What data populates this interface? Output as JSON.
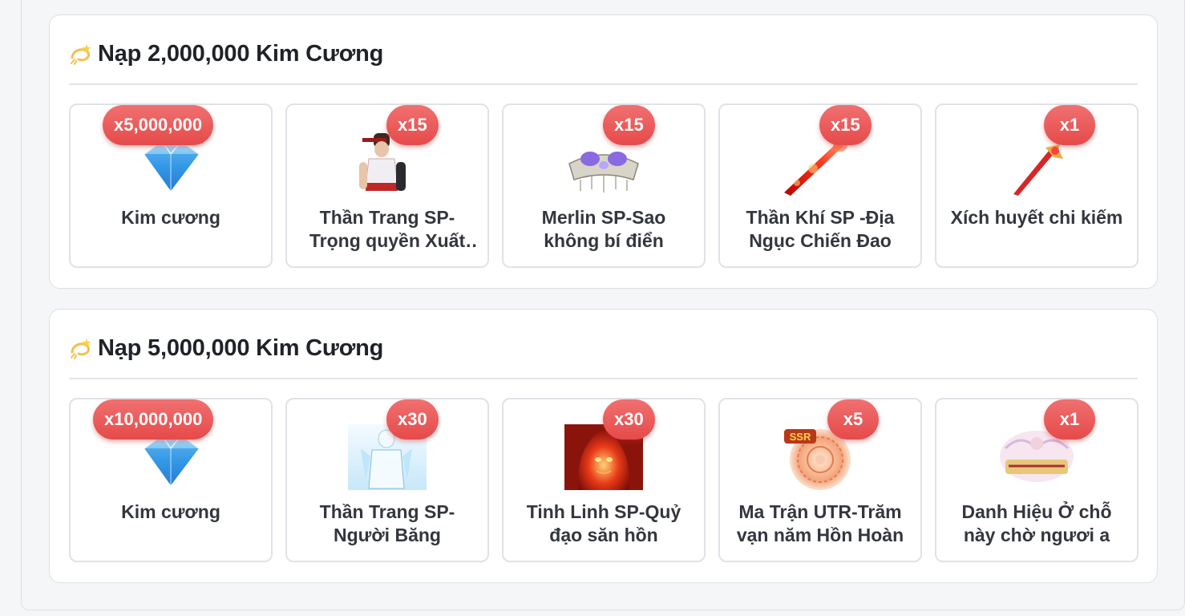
{
  "tiers": [
    {
      "icon": "dizzy-star-icon",
      "title": "Nạp 2,000,000 Kim Cương",
      "items": [
        {
          "qty": "x5,000,000",
          "name": "Kim cương",
          "icon": "diamond-icon"
        },
        {
          "qty": "x15",
          "name": "Thần Trang SP-Trọng quyền Xuất Kích",
          "icon": "fighter-costume-icon"
        },
        {
          "qty": "x15",
          "name": "Merlin SP-Sao không bí điển",
          "icon": "crown-artifact-icon"
        },
        {
          "qty": "x15",
          "name": "Thần Khí SP -Địa Ngục Chiến Đao",
          "icon": "fire-blade-icon"
        },
        {
          "qty": "x1",
          "name": "Xích huyết chi kiếm",
          "icon": "red-sword-icon"
        }
      ]
    },
    {
      "icon": "dizzy-star-icon",
      "title": "Nạp 5,000,000 Kim Cương",
      "items": [
        {
          "qty": "x10,000,000",
          "name": "Kim cương",
          "icon": "diamond-icon"
        },
        {
          "qty": "x30",
          "name": "Thần Trang SP-Người Băng",
          "icon": "ice-costume-icon"
        },
        {
          "qty": "x30",
          "name": "Tinh Linh SP-Quỷ đạo săn hồn",
          "icon": "flame-spirit-icon"
        },
        {
          "qty": "x5",
          "name": "Ma Trận UTR-Trăm vạn năm Hồn Hoàn",
          "icon": "ssr-ring-icon"
        },
        {
          "qty": "x1",
          "name": "Danh Hiệu Ở chỗ này chờ ngươi a",
          "icon": "title-banner-icon"
        }
      ]
    }
  ],
  "colors": {
    "badge": "#e64a4a",
    "title": "#1f2328",
    "item_text": "#33373d"
  }
}
